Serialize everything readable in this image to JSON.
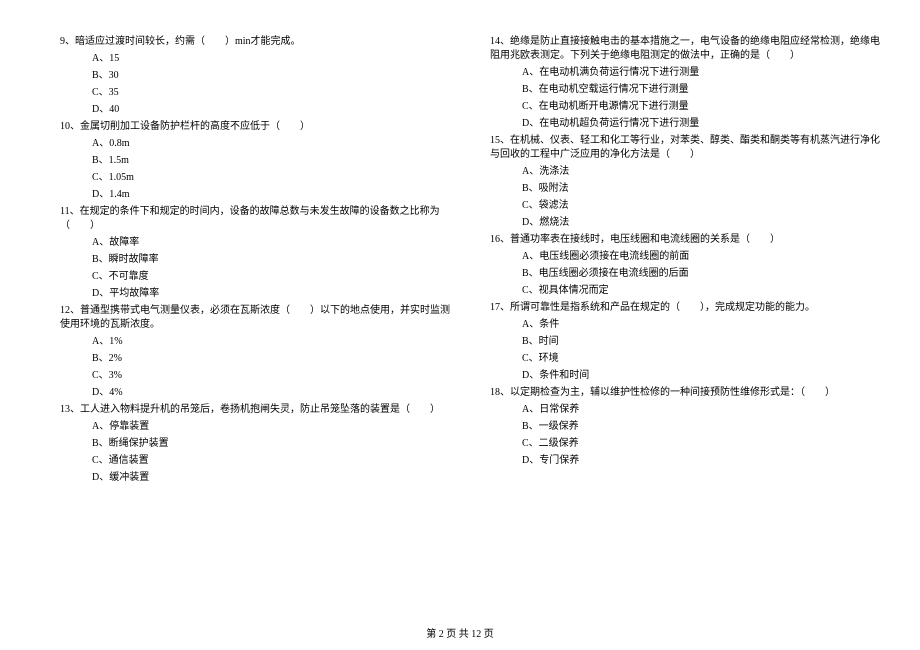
{
  "left_column": {
    "questions": [
      {
        "num": "9、",
        "text": "暗适应过渡时间较长，约需（　　）min才能完成。",
        "options": [
          "A、15",
          "B、30",
          "C、35",
          "D、40"
        ]
      },
      {
        "num": "10、",
        "text": "金属切削加工设备防护栏杆的高度不应低于（　　）",
        "options": [
          "A、0.8m",
          "B、1.5m",
          "C、1.05m",
          "D、1.4m"
        ]
      },
      {
        "num": "11、",
        "text": "在规定的条件下和规定的时间内，设备的故障总数与未发生故障的设备数之比称为（　　）",
        "options": [
          "A、故障率",
          "B、瞬时故障率",
          "C、不可靠度",
          "D、平均故障率"
        ]
      },
      {
        "num": "12、",
        "text": "普通型携带式电气测量仪表，必须在瓦斯浓度（　　）以下的地点使用，并实时监测使用环境的瓦斯浓度。",
        "options": [
          "A、1%",
          "B、2%",
          "C、3%",
          "D、4%"
        ]
      },
      {
        "num": "13、",
        "text": "工人进入物料提升机的吊笼后，卷扬机抱闸失灵，防止吊笼坠落的装置是（　　）",
        "options": [
          "A、停靠装置",
          "B、断绳保护装置",
          "C、通信装置",
          "D、缓冲装置"
        ]
      }
    ]
  },
  "right_column": {
    "questions": [
      {
        "num": "14、",
        "text": "绝缘是防止直接接触电击的基本措施之一，电气设备的绝缘电阻应经常检测，绝缘电阻用兆欧表测定。下列关于绝缘电阻测定的做法中，正确的是（　　）",
        "options": [
          "A、在电动机满负荷运行情况下进行测量",
          "B、在电动机空载运行情况下进行测量",
          "C、在电动机断开电源情况下进行测量",
          "D、在电动机超负荷运行情况下进行测量"
        ]
      },
      {
        "num": "15、",
        "text": "在机械、仪表、轻工和化工等行业，对苯类、醇类、酯类和酮类等有机蒸汽进行净化与回收的工程中广泛应用的净化方法是（　　）",
        "options": [
          "A、洗涤法",
          "B、吸附法",
          "C、袋滤法",
          "D、燃烧法"
        ]
      },
      {
        "num": "16、",
        "text": "普通功率表在接线时，电压线圈和电流线圈的关系是（　　）",
        "options": [
          "A、电压线圈必须接在电流线圈的前面",
          "B、电压线圈必须接在电流线圈的后面",
          "C、视具体情况而定"
        ]
      },
      {
        "num": "17、",
        "text": "所谓可靠性是指系统和产品在规定的（　　），完成规定功能的能力。",
        "options": [
          "A、条件",
          "B、时间",
          "C、环境",
          "D、条件和时间"
        ]
      },
      {
        "num": "18、",
        "text": "以定期检查为主，辅以维护性检修的一种间接预防性维修形式是：（　　）",
        "options": [
          "A、日常保养",
          "B、一级保养",
          "C、二级保养",
          "D、专门保养"
        ]
      }
    ]
  },
  "footer": "第 2 页 共 12 页"
}
